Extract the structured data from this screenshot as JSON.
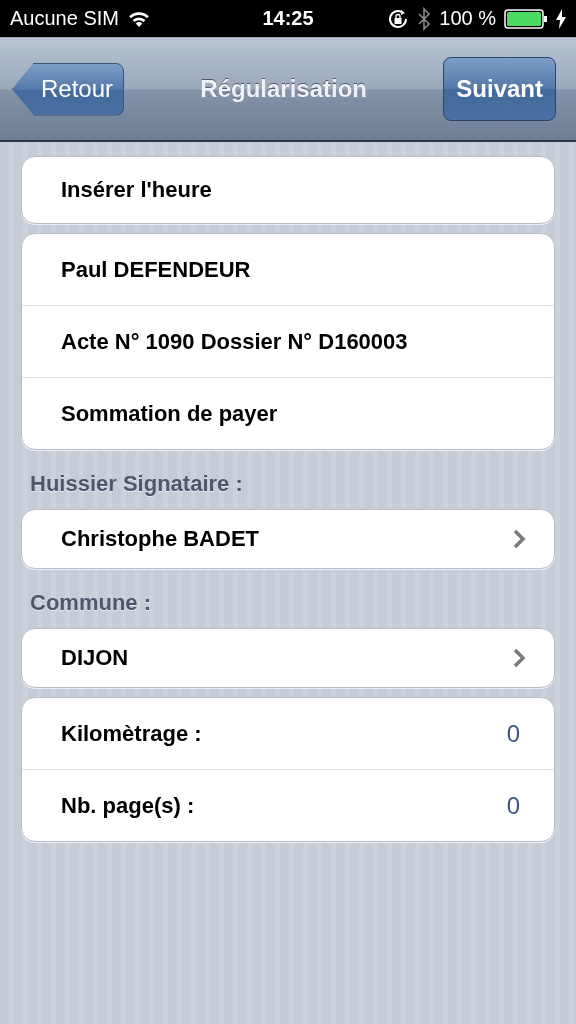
{
  "status_bar": {
    "carrier": "Aucune SIM",
    "time": "14:25",
    "battery": "100 %"
  },
  "nav_bar": {
    "back": "Retour",
    "title": "Régularisation",
    "next": "Suivant"
  },
  "sections": [
    {
      "rows": [
        {
          "kind": "plain",
          "label": "Insérer l'heure"
        }
      ]
    },
    {
      "rows": [
        {
          "kind": "plain",
          "label": "Paul DEFENDEUR"
        },
        {
          "kind": "plain",
          "label": "Acte N° 1090 Dossier N° D160003"
        },
        {
          "kind": "plain",
          "label": "Sommation de payer"
        }
      ]
    },
    {
      "header": "Huissier Signataire :",
      "rows": [
        {
          "kind": "disclosure",
          "label": "Christophe BADET"
        }
      ]
    },
    {
      "header": "Commune :",
      "rows": [
        {
          "kind": "disclosure",
          "label": "DIJON"
        }
      ]
    },
    {
      "rows": [
        {
          "kind": "value",
          "label": "Kilomètrage :",
          "value": "0"
        },
        {
          "kind": "value",
          "label": "Nb. page(s) :",
          "value": "0"
        }
      ]
    }
  ]
}
